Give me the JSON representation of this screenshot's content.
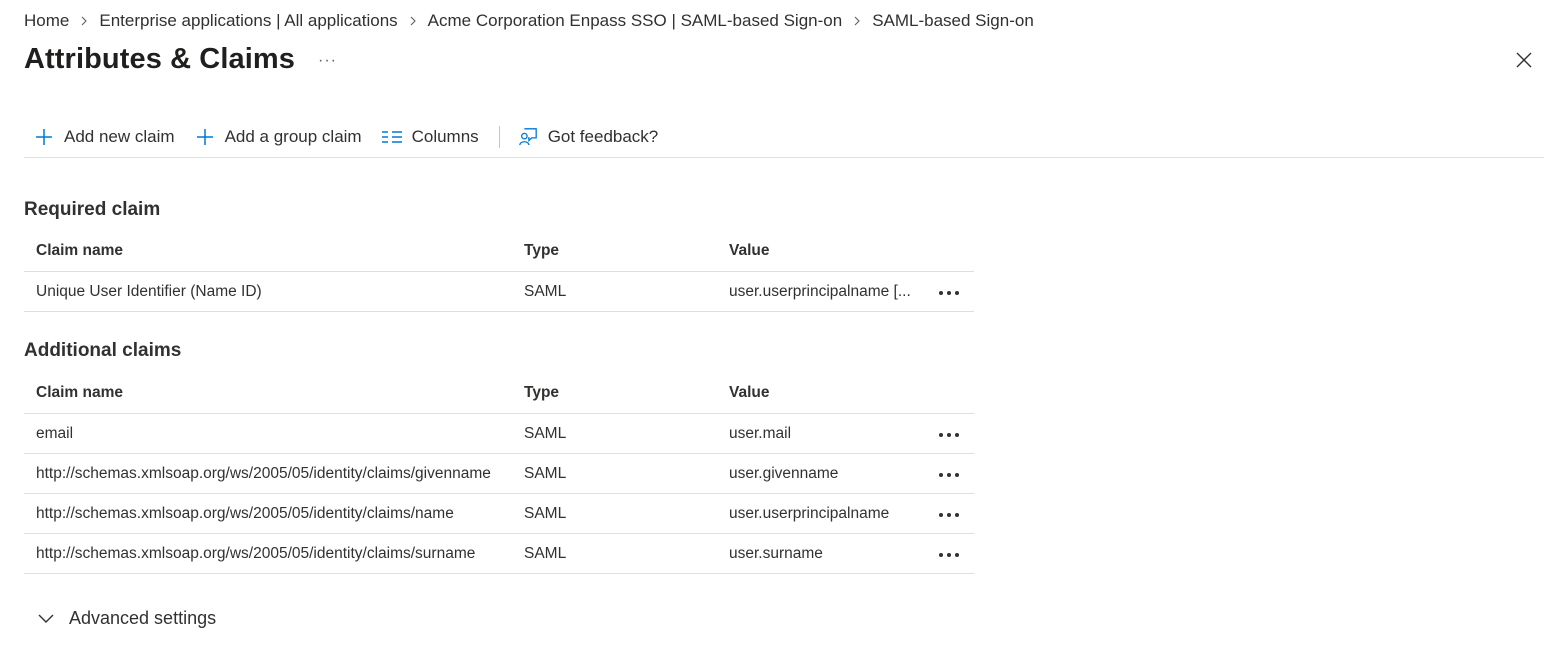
{
  "breadcrumb": [
    {
      "label": "Home"
    },
    {
      "label": "Enterprise applications | All applications"
    },
    {
      "label": "Acme Corporation Enpass SSO | SAML-based Sign-on"
    },
    {
      "label": "SAML-based Sign-on"
    }
  ],
  "page": {
    "title": "Attributes & Claims",
    "more_label": "···"
  },
  "toolbar": {
    "add_claim": "Add new claim",
    "add_group_claim": "Add a group claim",
    "columns": "Columns",
    "feedback": "Got feedback?"
  },
  "required": {
    "title": "Required claim",
    "headers": {
      "name": "Claim name",
      "type": "Type",
      "value": "Value"
    },
    "rows": [
      {
        "name": "Unique User Identifier (Name ID)",
        "type": "SAML",
        "value": "user.userprincipalname [..."
      }
    ]
  },
  "additional": {
    "title": "Additional claims",
    "headers": {
      "name": "Claim name",
      "type": "Type",
      "value": "Value"
    },
    "rows": [
      {
        "name": "email",
        "type": "SAML",
        "value": "user.mail"
      },
      {
        "name": "http://schemas.xmlsoap.org/ws/2005/05/identity/claims/givenname",
        "type": "SAML",
        "value": "user.givenname"
      },
      {
        "name": "http://schemas.xmlsoap.org/ws/2005/05/identity/claims/name",
        "type": "SAML",
        "value": "user.userprincipalname"
      },
      {
        "name": "http://schemas.xmlsoap.org/ws/2005/05/identity/claims/surname",
        "type": "SAML",
        "value": "user.surname"
      }
    ]
  },
  "advanced": {
    "label": "Advanced settings"
  },
  "colors": {
    "accent": "#0078d4",
    "text": "#323130",
    "divider": "#e1dfdd"
  }
}
